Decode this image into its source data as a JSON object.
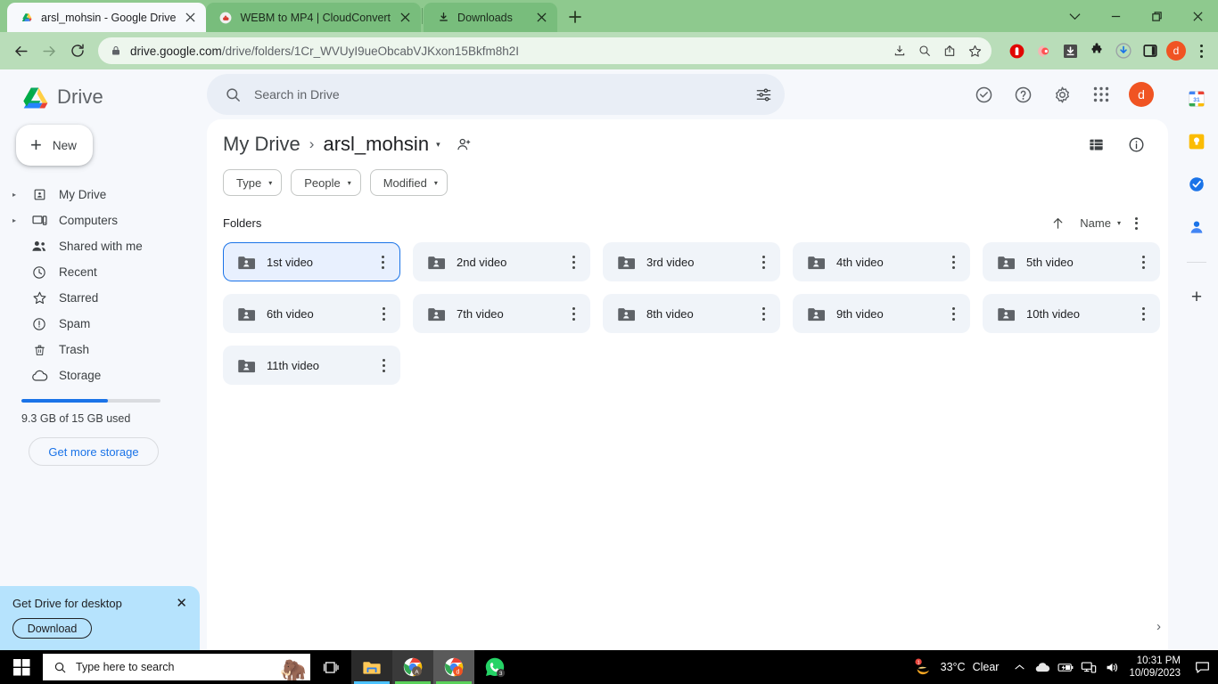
{
  "browser": {
    "tabs": [
      {
        "title": "arsl_mohsin - Google Drive",
        "favicon": "drive-icon",
        "active": true
      },
      {
        "title": "WEBM to MP4 | CloudConvert",
        "favicon": "cloudconvert-icon",
        "active": false
      },
      {
        "title": "Downloads",
        "favicon": "download-icon",
        "active": false
      }
    ],
    "new_tab_label": "+",
    "window_controls": {
      "minimize": "—",
      "maximize": "❐",
      "close": "✕",
      "tab_search": "∨"
    },
    "url": {
      "host": "drive.google.com",
      "path": "/drive/folders/1Cr_WVUyI9ueObcabVJKxon15Bkfm8h2I"
    },
    "omnibox_icons": [
      "lock-icon",
      "install-icon",
      "zoom-icon",
      "share-icon",
      "bookmark-star-icon"
    ],
    "extension_icons": [
      "adblock-icon",
      "extension-pink-icon",
      "download-manager-icon",
      "puzzle-extensions-icon",
      "idm-download-icon",
      "sidepanel-icon"
    ],
    "profile_initial": "d",
    "menu_icon": "chrome-menu-icon"
  },
  "drive": {
    "brand": "Drive",
    "new_button": "New",
    "search": {
      "placeholder": "Search in Drive",
      "icon": "search-icon",
      "filter_icon": "tune-icon"
    },
    "header_icons": [
      "support-status-icon",
      "help-icon",
      "settings-gear-icon",
      "google-apps-grid-icon"
    ],
    "account_initial": "d",
    "nav_items": [
      {
        "label": "My Drive",
        "icon": "my-drive-icon",
        "expandable": true
      },
      {
        "label": "Computers",
        "icon": "computers-icon",
        "expandable": true
      },
      {
        "label": "Shared with me",
        "icon": "shared-people-icon",
        "expandable": false
      },
      {
        "label": "Recent",
        "icon": "clock-icon",
        "expandable": false
      },
      {
        "label": "Starred",
        "icon": "star-icon",
        "expandable": false
      },
      {
        "label": "Spam",
        "icon": "spam-icon",
        "expandable": false
      },
      {
        "label": "Trash",
        "icon": "trash-icon",
        "expandable": false
      },
      {
        "label": "Storage",
        "icon": "cloud-icon",
        "expandable": false
      }
    ],
    "storage": {
      "used_percent": 62,
      "text": "9.3 GB of 15 GB used",
      "cta": "Get more storage",
      "accent": "#1a73e8"
    },
    "promo": {
      "title": "Get Drive for desktop",
      "button": "Download",
      "close": "✕"
    },
    "breadcrumb": {
      "root": "My Drive",
      "separator": "›",
      "current": "arsl_mohsin",
      "caret": "▾",
      "share_icon": "person-add-icon"
    },
    "view_icons": [
      "list-view-icon",
      "details-info-icon"
    ],
    "filter_chips": [
      {
        "label": "Type",
        "caret": "▾"
      },
      {
        "label": "People",
        "caret": "▾"
      },
      {
        "label": "Modified",
        "caret": "▾"
      }
    ],
    "section_label": "Folders",
    "sort": {
      "direction_icon": "arrow-up-icon",
      "label": "Name",
      "caret": "▾",
      "more_icon": "more-options-icon"
    },
    "folders": [
      {
        "name": "1st video",
        "icon": "shared-folder-icon",
        "selected": true
      },
      {
        "name": "2nd video",
        "icon": "shared-folder-icon",
        "selected": false
      },
      {
        "name": "3rd video",
        "icon": "shared-folder-icon",
        "selected": false
      },
      {
        "name": "4th video",
        "icon": "shared-folder-icon",
        "selected": false
      },
      {
        "name": "5th video",
        "icon": "shared-folder-icon",
        "selected": false
      },
      {
        "name": "6th video",
        "icon": "shared-folder-icon",
        "selected": false
      },
      {
        "name": "7th video",
        "icon": "shared-folder-icon",
        "selected": false
      },
      {
        "name": "8th video",
        "icon": "shared-folder-icon",
        "selected": false
      },
      {
        "name": "9th video",
        "icon": "shared-folder-icon",
        "selected": false
      },
      {
        "name": "10th video",
        "icon": "shared-folder-icon",
        "selected": false
      },
      {
        "name": "11th video",
        "icon": "shared-folder-icon",
        "selected": false
      }
    ],
    "panel_expand": "›",
    "side_rail": [
      "google-calendar-icon",
      "google-keep-icon",
      "google-tasks-icon",
      "google-contacts-icon",
      "add-app-icon"
    ]
  },
  "taskbar": {
    "start_icon": "windows-start-icon",
    "search_placeholder": "Type here to search",
    "search_icon": "search-icon",
    "buttons": [
      {
        "name": "task-view-icon"
      },
      {
        "name": "file-explorer-icon"
      },
      {
        "name": "chrome-profile-a-icon",
        "badge": "A"
      },
      {
        "name": "chrome-profile-d-icon",
        "badge": "d"
      },
      {
        "name": "whatsapp-icon",
        "badge": "3"
      }
    ],
    "weather": {
      "temp": "33°C",
      "condition": "Clear",
      "badge": "1"
    },
    "tray_icons": [
      "chevron-up-icon",
      "onedrive-cloud-icon",
      "battery-charging-icon",
      "network-icon",
      "volume-icon"
    ],
    "clock": {
      "time": "10:31 PM",
      "date": "10/09/2023"
    },
    "action_center_icon": "action-center-icon"
  }
}
